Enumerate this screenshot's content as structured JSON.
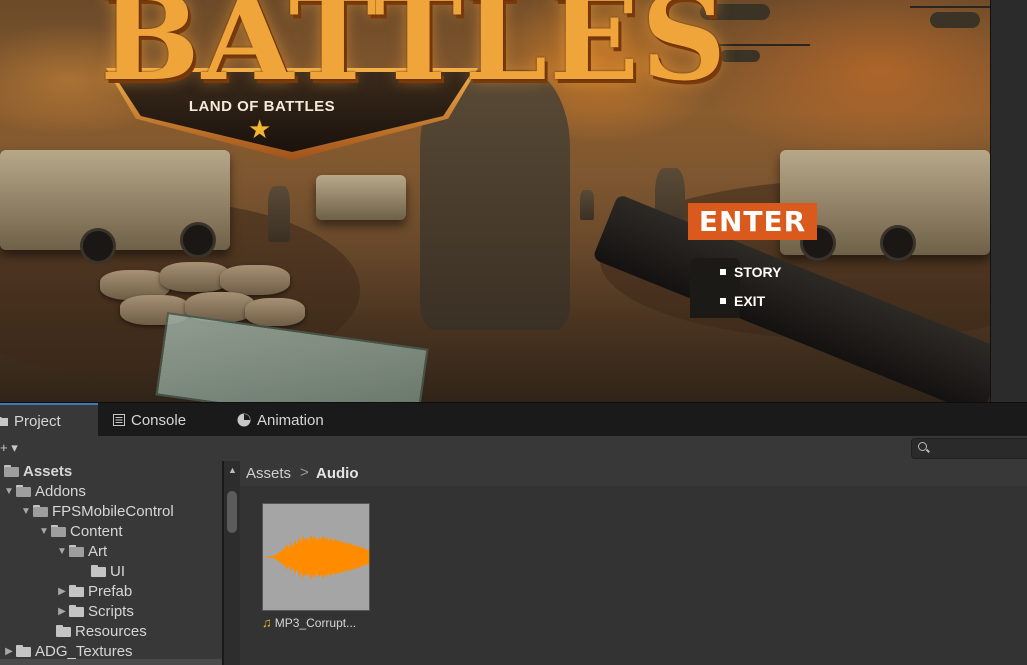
{
  "game": {
    "logo_title": "BATTLES",
    "logo_subtitle": "LAND OF BATTLES",
    "menu": {
      "enter_label": "ENTER",
      "story_label": "STORY",
      "exit_label": "EXIT"
    },
    "colors": {
      "enter_button": "#d95a1c",
      "logo_gold": "#f0a53a"
    }
  },
  "tabs": [
    {
      "label": "Project",
      "icon": "folder-icon",
      "active": true
    },
    {
      "label": "Console",
      "icon": "console-icon"
    },
    {
      "label": "Animation",
      "icon": "clock-icon"
    }
  ],
  "toolbar": {
    "create_label": "+ ▾",
    "search_placeholder": ""
  },
  "tree": {
    "items": [
      {
        "label": "Assets",
        "depth": 0,
        "expanded": true
      },
      {
        "label": "Addons",
        "depth": 1,
        "expanded": true
      },
      {
        "label": "FPSMobileControl",
        "depth": 2,
        "expanded": true
      },
      {
        "label": "Content",
        "depth": 3,
        "expanded": true
      },
      {
        "label": "Art",
        "depth": 4,
        "expanded": true
      },
      {
        "label": "UI",
        "depth": 5
      },
      {
        "label": "Prefab",
        "depth": 4,
        "expanded": false
      },
      {
        "label": "Scripts",
        "depth": 4,
        "expanded": false
      },
      {
        "label": "Resources",
        "depth": 3
      },
      {
        "label": "ADG_Textures",
        "depth": 1,
        "expanded": false
      }
    ]
  },
  "breadcrumb": {
    "root": "Assets",
    "separator": ">",
    "current": "Audio"
  },
  "assets": [
    {
      "label": "MP3_Corrupt...",
      "type": "audio",
      "icon": "music-note-icon",
      "waveform_color": "#ff8c00"
    }
  ]
}
